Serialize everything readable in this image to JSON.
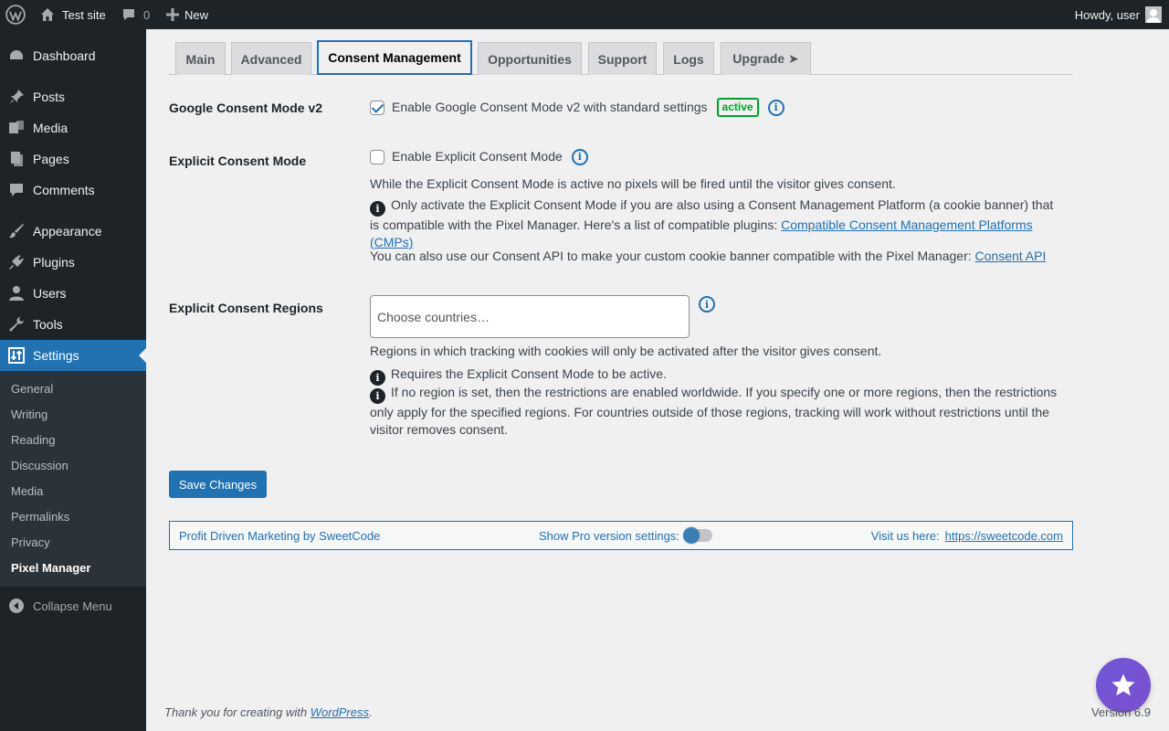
{
  "adminbar": {
    "site_name": "Test site",
    "comments_count": "0",
    "new_label": "New",
    "howdy": "Howdy, user"
  },
  "sidebar": {
    "items": [
      {
        "label": "Dashboard",
        "icon": "dashboard-icon"
      },
      {
        "label": "Posts",
        "icon": "pin-icon"
      },
      {
        "label": "Media",
        "icon": "media-icon"
      },
      {
        "label": "Pages",
        "icon": "pages-icon"
      },
      {
        "label": "Comments",
        "icon": "comment-icon"
      },
      {
        "label": "Appearance",
        "icon": "brush-icon"
      },
      {
        "label": "Plugins",
        "icon": "plug-icon"
      },
      {
        "label": "Users",
        "icon": "user-icon"
      },
      {
        "label": "Tools",
        "icon": "wrench-icon"
      },
      {
        "label": "Settings",
        "icon": "settings-icon"
      }
    ],
    "submenu": [
      "General",
      "Writing",
      "Reading",
      "Discussion",
      "Media",
      "Permalinks",
      "Privacy",
      "Pixel Manager"
    ],
    "collapse_label": "Collapse Menu"
  },
  "tabs": [
    "Main",
    "Advanced",
    "Consent Management",
    "Opportunities",
    "Support",
    "Logs",
    "Upgrade ➤"
  ],
  "gcm": {
    "label": "Google Consent Mode v2",
    "checkbox_label": "Enable Google Consent Mode v2 with standard settings",
    "checked": true,
    "badge": "active"
  },
  "explicit": {
    "label": "Explicit Consent Mode",
    "checkbox_label": "Enable Explicit Consent Mode",
    "checked": false,
    "desc": "While the Explicit Consent Mode is active no pixels will be fired until the visitor gives consent.",
    "note_text": "Only activate the Explicit Consent Mode if you are also using a Consent Management Platform (a cookie banner) that is compatible with the Pixel Manager. Here's a list of compatible plugins: ",
    "note_link": "Compatible Consent Management Platforms (CMPs)",
    "api_text": "You can also use our Consent API to make your custom cookie banner compatible with the Pixel Manager: ",
    "api_link": "Consent API"
  },
  "regions": {
    "label": "Explicit Consent Regions",
    "placeholder": "Choose countries…",
    "desc": "Regions in which tracking with cookies will only be activated after the visitor gives consent.",
    "note1": "Requires the Explicit Consent Mode to be active.",
    "note2": "If no region is set, then the restrictions are enabled worldwide. If you specify one or more regions, then the restrictions only apply for the specified regions. For countries outside of those regions, tracking will work without restrictions until the visitor removes consent."
  },
  "save_label": "Save Changes",
  "footer_box": {
    "brand": "Profit Driven Marketing by SweetCode",
    "pro_label": "Show Pro version settings:",
    "visit_label": "Visit us here:",
    "visit_link": "https://sweetcode.com"
  },
  "wpfooter": {
    "thanks_text": "Thank you for creating with ",
    "thanks_link": "WordPress",
    "thanks_end": ".",
    "version": "Version 6.9"
  }
}
